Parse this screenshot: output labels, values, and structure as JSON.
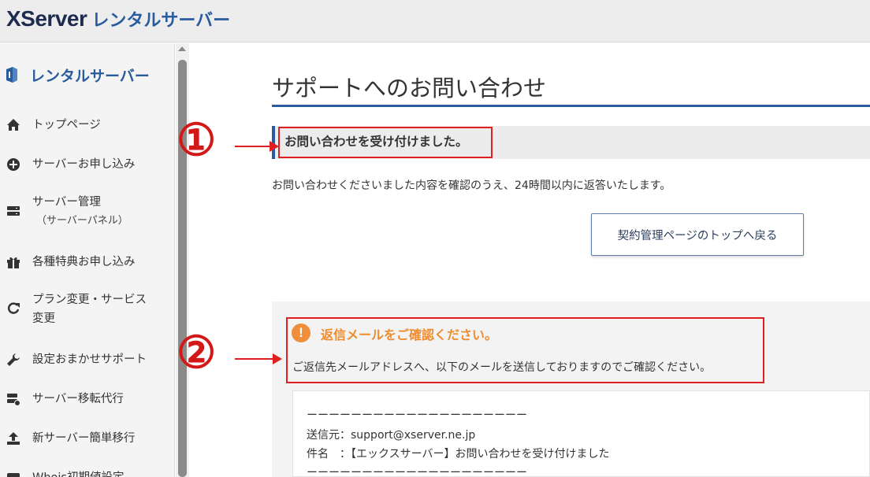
{
  "header": {
    "logo_main": "XServer",
    "logo_sub": "レンタルサーバー"
  },
  "sidebar": {
    "title": "レンタルサーバー",
    "items": [
      {
        "label": "トップページ",
        "icon": "home-icon"
      },
      {
        "label": "サーバーお申し込み",
        "icon": "plus-circle-icon"
      },
      {
        "label": "サーバー管理",
        "sub": "（サーバーパネル）",
        "icon": "server-icon"
      },
      {
        "label": "各種特典お申し込み",
        "icon": "gift-icon"
      },
      {
        "label": "プラン変更・サービス",
        "sub": "変更",
        "icon": "refresh-icon"
      },
      {
        "label": "設定おまかせサポート",
        "icon": "wrench-icon"
      },
      {
        "label": "サーバー移転代行",
        "icon": "server-transfer-icon"
      },
      {
        "label": "新サーバー簡単移行",
        "icon": "upload-icon"
      },
      {
        "label": "Whois初期値設定",
        "icon": "whois-icon"
      }
    ]
  },
  "main": {
    "title": "サポートへのお問い合わせ",
    "notice": "お問い合わせを受け付けました。",
    "body_text": "お問い合わせくださいました内容を確認のうえ、24時間以内に返答いたします。",
    "back_button": "契約管理ページのトップへ戻る",
    "mail_notice": {
      "icon_glyph": "!",
      "title": "返信メールをご確認ください。",
      "text": "ご返信先メールアドレスへ、以下のメールを送信しておりますのでご確認ください。"
    },
    "mail_lines": [
      "ーーーーーーーーーーーーーーーーーーーー",
      "送信元：support@xserver.ne.jp",
      "件名　：【エックスサーバー】お問い合わせを受け付けました",
      "ーーーーーーーーーーーーーーーーーーーー"
    ]
  },
  "annotations": {
    "one": "①",
    "two": "②"
  },
  "colors": {
    "accent": "#2a5b9e",
    "highlight": "#e02020",
    "warning": "#ee8c2f"
  }
}
